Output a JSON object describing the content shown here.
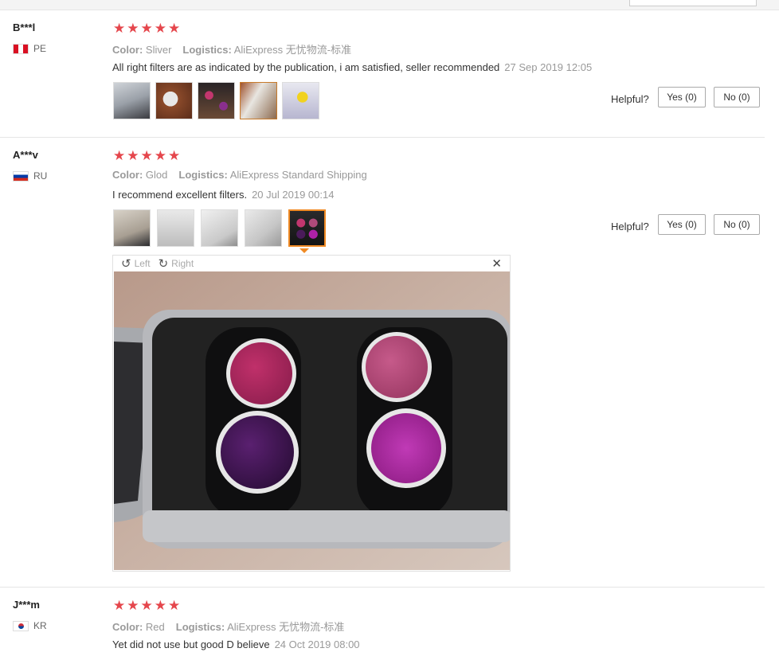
{
  "reviews": [
    {
      "user": "B***l",
      "country": "PE",
      "color_label": "Color:",
      "color": "Sliver",
      "logistics_label": "Logistics:",
      "logistics": "AliExpress 无忧物流-标准",
      "text": "All right filters are as indicated by the publication, i am satisfied, seller recommended",
      "date": "27 Sep 2019 12:05",
      "helpful": "Helpful?",
      "yes": "Yes (0)",
      "no": "No (0)"
    },
    {
      "user": "A***v",
      "country": "RU",
      "color_label": "Color:",
      "color": "Glod",
      "logistics_label": "Logistics:",
      "logistics": "AliExpress Standard Shipping",
      "text": "I recommend excellent filters.",
      "date": "20 Jul 2019 00:14",
      "helpful": "Helpful?",
      "yes": "Yes (0)",
      "no": "No (0)"
    },
    {
      "user": "J***m",
      "country": "KR",
      "color_label": "Color:",
      "color": "Red",
      "logistics_label": "Logistics:",
      "logistics": "AliExpress 无忧物流-标准",
      "text": "Yet did not use but good D believe",
      "date": "24 Oct 2019 08:00"
    }
  ],
  "viewer": {
    "left": "Left",
    "right": "Right",
    "close": "✕",
    "rotate_left_icon": "rotate-left-icon",
    "rotate_right_icon": "rotate-right-icon"
  },
  "star": "★",
  "colors": {
    "star": "#e5464c",
    "active_border": "#f08a24"
  }
}
